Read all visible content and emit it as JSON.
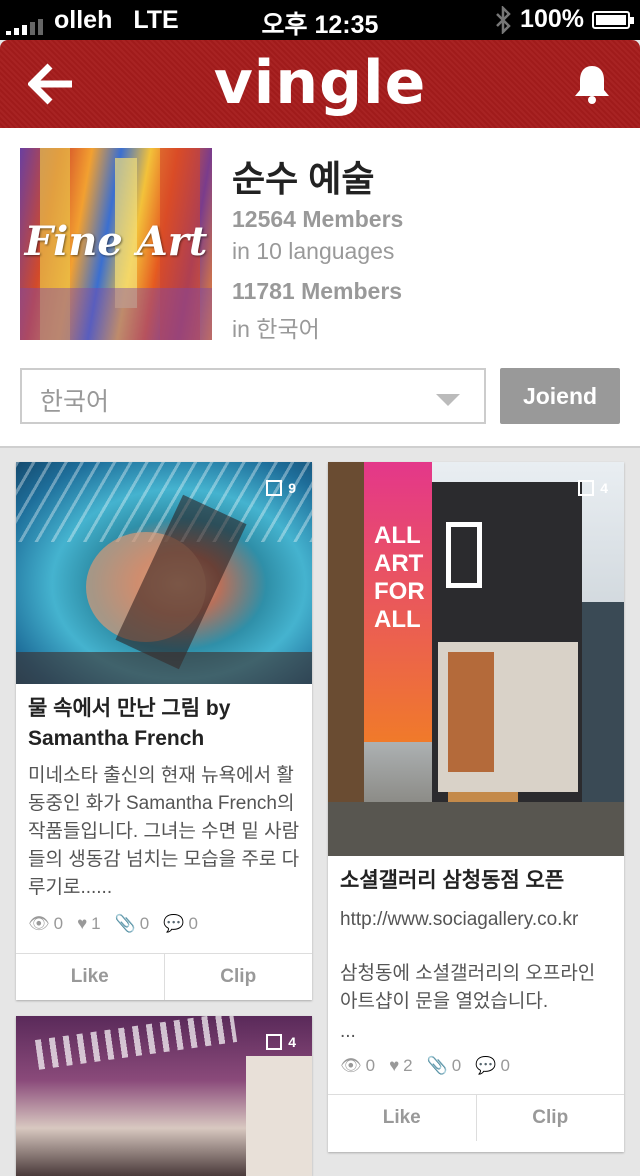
{
  "status": {
    "carrier": "olleh",
    "network": "LTE",
    "time": "오후 12:35",
    "battery": "100%"
  },
  "colors": {
    "brand": "#a51c1c",
    "join_button": "#999999"
  },
  "navbar": {
    "back_icon": "back-arrow-icon",
    "logo": "vingle",
    "bell_icon": "bell-icon"
  },
  "community": {
    "name": "순수 예술",
    "cover_text": "Fine Art",
    "members_total": "12564 Members",
    "languages": "in 10 languages",
    "members_local": "11781 Members",
    "language_local": "in 한국어"
  },
  "language_select": {
    "value": "한국어"
  },
  "join_button": "Joiend",
  "cards": [
    {
      "count": "9",
      "title": "물 속에서 만난 그림  by Samantha French",
      "desc": "미네소타 출신의 현재 뉴욕에서 활동중인 화가 Samantha French의 작품들입니다. 그녀는 수면 밑 사람들의 생동감 넘치는 모습을 주로 다루기로......",
      "views": "0",
      "likes": "1",
      "clips": "0",
      "comments": "0",
      "like_label": "Like",
      "clip_label": "Clip"
    },
    {
      "count": "4",
      "banner": "ALL ART FOR ALL",
      "title": "소셜갤러리 삼청동점 오픈",
      "link": "http://www.sociagallery.co.kr",
      "desc": "삼청동에 소셜갤러리의 오프라인 아트샵이 문을 열었습니다.",
      "ellipsis": "...",
      "views": "0",
      "likes": "2",
      "clips": "0",
      "comments": "0",
      "like_label": "Like",
      "clip_label": "Clip"
    },
    {
      "count": "4"
    }
  ]
}
